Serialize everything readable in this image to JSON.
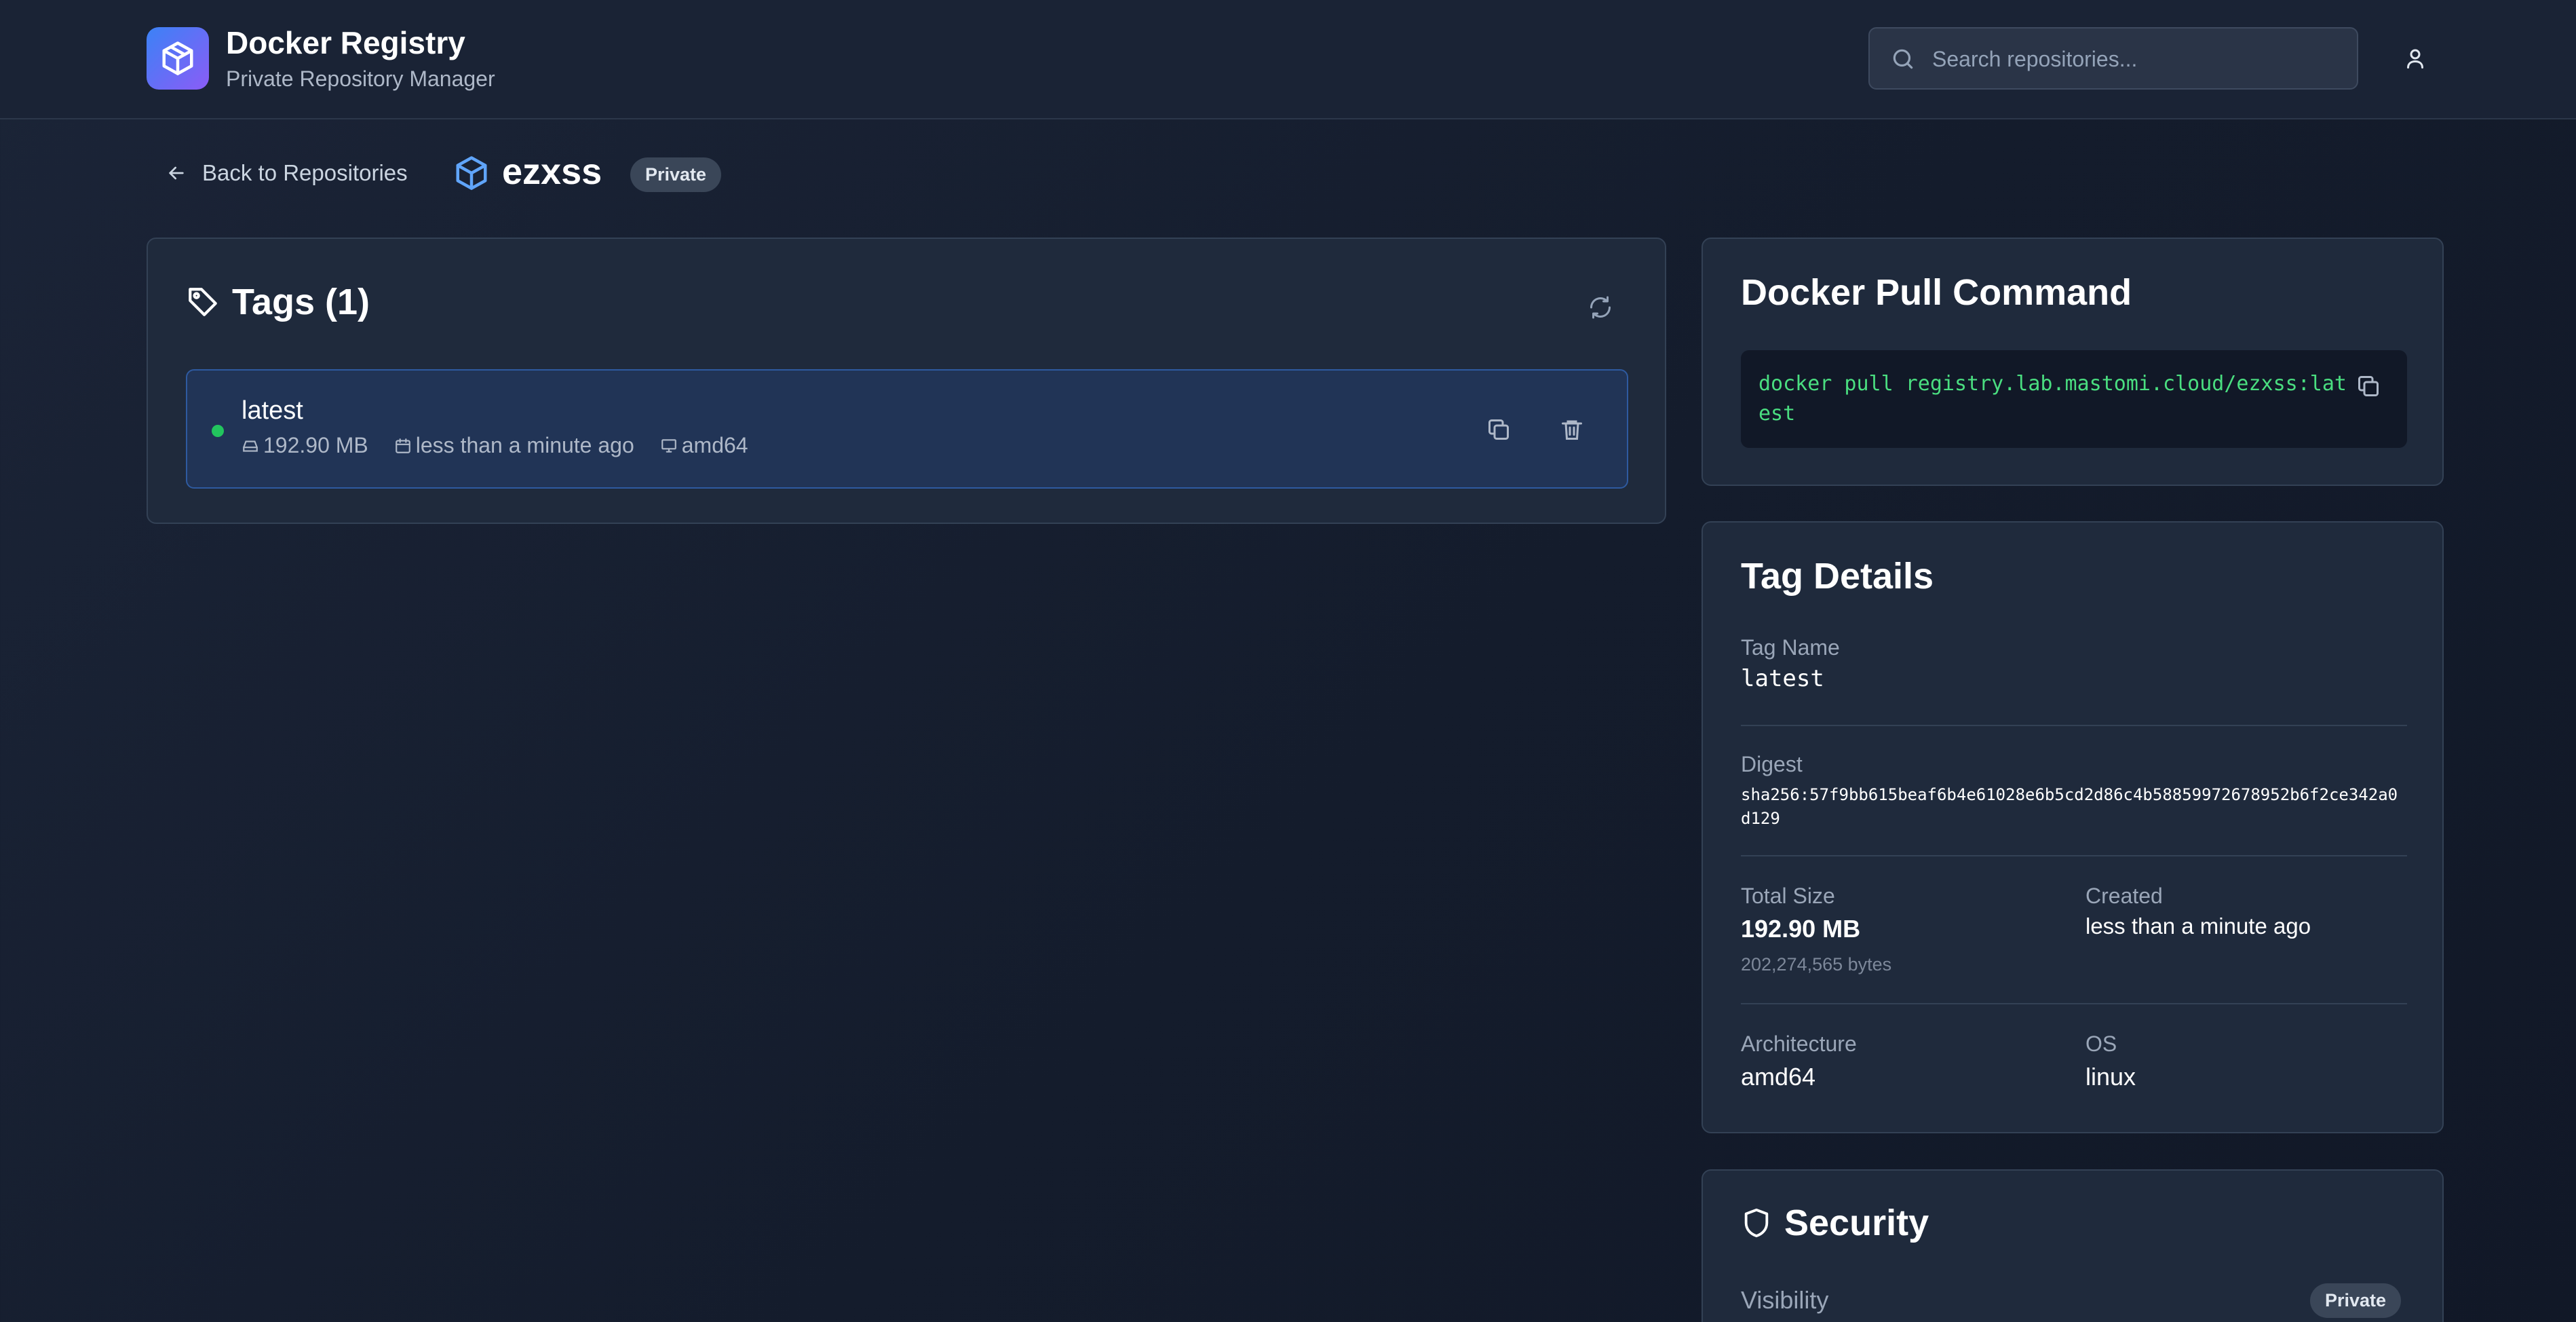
{
  "header": {
    "app_title": "Docker Registry",
    "app_subtitle": "Private Repository Manager",
    "search_placeholder": "Search repositories...",
    "logo_icon": "container-box-icon",
    "user_icon": "user-icon"
  },
  "breadcrumb": {
    "back_label": "Back to Repositories",
    "repo_name": "ezxss",
    "visibility_badge": "Private"
  },
  "tags": {
    "title": "Tags (1)",
    "items": [
      {
        "name": "latest",
        "size": "192.90 MB",
        "created": "less than a minute ago",
        "architecture": "amd64",
        "status_color": "#22c55e"
      }
    ]
  },
  "pull_command": {
    "title": "Docker Pull Command",
    "command": "docker pull registry.lab.mastomi.cloud/ezxss:latest"
  },
  "tag_details": {
    "title": "Tag Details",
    "tag_name_label": "Tag Name",
    "tag_name_value": "latest",
    "digest_label": "Digest",
    "digest_value": "sha256:57f9bb615beaf6b4e61028e6b5cd2d86c4b58859972678952b6f2ce342a0d129",
    "total_size_label": "Total Size",
    "total_size_value": "192.90 MB",
    "total_size_bytes": "202,274,565 bytes",
    "created_label": "Created",
    "created_value": "less than a minute ago",
    "architecture_label": "Architecture",
    "architecture_value": "amd64",
    "os_label": "OS",
    "os_value": "linux"
  },
  "security": {
    "title": "Security",
    "visibility_label": "Visibility",
    "visibility_value": "Private"
  },
  "colors": {
    "accent": "#3b82f6",
    "accent_purple": "#8b5cf6",
    "command_green": "#4ade80",
    "status_green": "#22c55e"
  }
}
